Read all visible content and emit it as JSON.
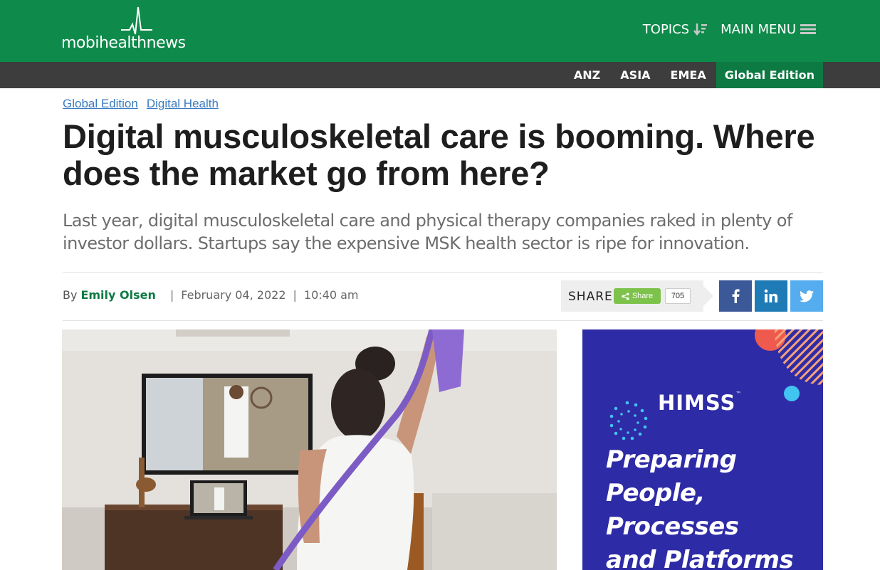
{
  "header": {
    "logo": {
      "part1": "mobi",
      "part2": "health",
      "part3": "news"
    },
    "nav": [
      {
        "label": "TOPICS",
        "icon": "sort-down-icon"
      },
      {
        "label": "MAIN MENU",
        "icon": "hamburger-icon"
      }
    ]
  },
  "editions": [
    {
      "label": "ANZ",
      "active": false
    },
    {
      "label": "ASIA",
      "active": false
    },
    {
      "label": "EMEA",
      "active": false
    },
    {
      "label": "Global Edition",
      "active": true
    }
  ],
  "article": {
    "breadcrumbs": [
      "Global Edition",
      "Digital Health"
    ],
    "headline": "Digital musculoskeletal care is booming. Where does the market go from here?",
    "dek": "Last year, digital musculoskeletal care and physical therapy companies raked in plenty of investor dollars. Startups say the expensive MSK health sector is ripe for innovation.",
    "byline": {
      "by": "By",
      "author": "Emily Olsen",
      "separator": "|",
      "date": "February 04, 2022",
      "time": "10:40 am"
    },
    "share": {
      "label": "SHARE",
      "button_label": "Share",
      "count": "705"
    },
    "social": [
      {
        "name": "facebook",
        "icon": "facebook-icon",
        "color": "#3b5998"
      },
      {
        "name": "linkedin",
        "icon": "linkedin-icon",
        "color": "#1f7bb6"
      },
      {
        "name": "twitter",
        "icon": "twitter-icon",
        "color": "#55acee"
      }
    ]
  },
  "ad": {
    "brand": "HIMSS",
    "trademark": "™",
    "tagline": [
      "Preparing",
      "People,",
      "Processes",
      "and Platforms"
    ]
  },
  "colors": {
    "header_green": "#0e8a4a",
    "edition_bar": "#3d3d3d",
    "active_edition": "#0e7a43",
    "link_blue": "#3a7bbf",
    "ad_blue": "#2e2ba6"
  }
}
